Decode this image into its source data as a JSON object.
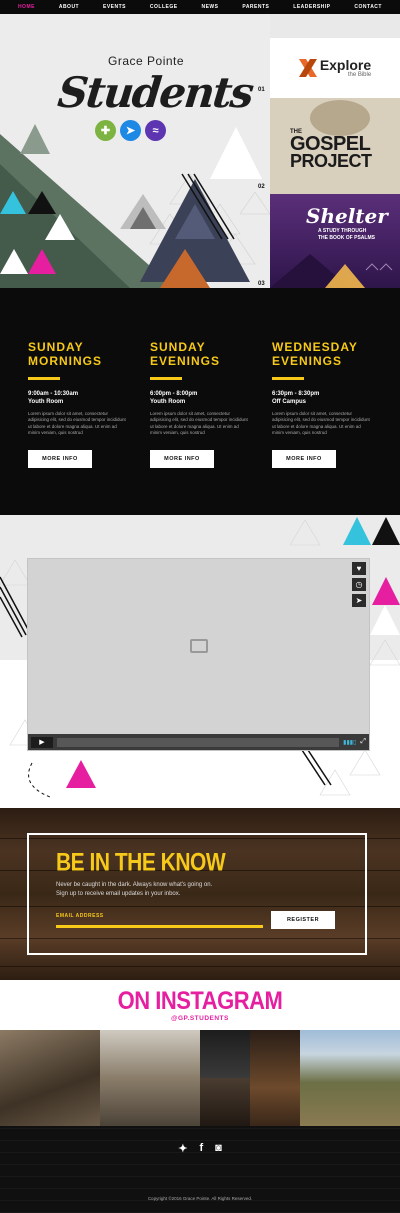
{
  "nav": {
    "items": [
      {
        "label": "HOME"
      },
      {
        "label": "ABOUT"
      },
      {
        "label": "EVENTS"
      },
      {
        "label": "COLLEGE"
      },
      {
        "label": "NEWS"
      },
      {
        "label": "PARENTS"
      },
      {
        "label": "LEADERSHIP"
      },
      {
        "label": "CONTACT"
      }
    ],
    "active_color": "#e61ea0"
  },
  "hero": {
    "logo_line1": "Grace Pointe",
    "logo_line2": "Students",
    "badge_icons": [
      "plus-icon",
      "arrow-icon",
      "wave-icon"
    ],
    "slides": [
      {
        "number": "01",
        "title": "Explore",
        "subtitle": "the Bible"
      },
      {
        "number": "02",
        "title_small": "THE",
        "title_line1": "GOSPEL",
        "title_line2": "PROJECT"
      },
      {
        "number": "03",
        "title": "Shelter",
        "subtitle_line1": "A STUDY THROUGH",
        "subtitle_line2": "THE BOOK OF PSALMS"
      }
    ]
  },
  "schedule": {
    "columns": [
      {
        "title_line1": "SUNDAY",
        "title_line2": "MORNINGS",
        "time": "9:00am - 10:30am",
        "place": "Youth Room",
        "body": "Lorem ipsum dolor sit amet, consectetur adipisicing elit, sed do eiusmod tempor incididunt ut labore et dolore magna aliqua. Ut enim ad minim veniam, quis nostrud",
        "button": "MORE INFO"
      },
      {
        "title_line1": "SUNDAY",
        "title_line2": "EVENINGS",
        "time": "6:00pm - 8:00pm",
        "place": "Youth Room",
        "body": "Lorem ipsum dolor sit amet, consectetur adipisicing elit, sed do eiusmod tempor incididunt ut labore et dolore magna aliqua. Ut enim ad minim veniam, quis nostrud",
        "button": "MORE INFO"
      },
      {
        "title_line1": "WEDNESDAY",
        "title_line2": "EVENINGS",
        "time": "6:30pm - 8:30pm",
        "place": "Off Campus",
        "body": "Lorem ipsum dolor sit amet, consectetur adipisicing elit, sed do eiusmod tempor incididunt ut labore et dolore magna aliqua. Ut enim ad minim veniam, quis nostrud",
        "button": "MORE INFO"
      }
    ],
    "accent": "#f7c919"
  },
  "video": {
    "side_icons": [
      "heart-icon",
      "clock-icon",
      "send-icon"
    ]
  },
  "newsletter": {
    "title": "BE IN THE KNOW",
    "text_line1": "Never be caught in the dark. Always know what's going on.",
    "text_line2": "Sign up to receive email updates in your inbox.",
    "email_placeholder": "EMAIL ADDRESS",
    "button": "REGISTER"
  },
  "instagram": {
    "title": "ON INSTAGRAM",
    "handle": "@GP.STUDENTS",
    "color": "#e61ea0"
  },
  "footer": {
    "social_icons": [
      "twitter-icon",
      "facebook-icon",
      "instagram-icon"
    ],
    "copyright": "Copyright ©2016 Grace Pointe. All Rights Reserved."
  }
}
